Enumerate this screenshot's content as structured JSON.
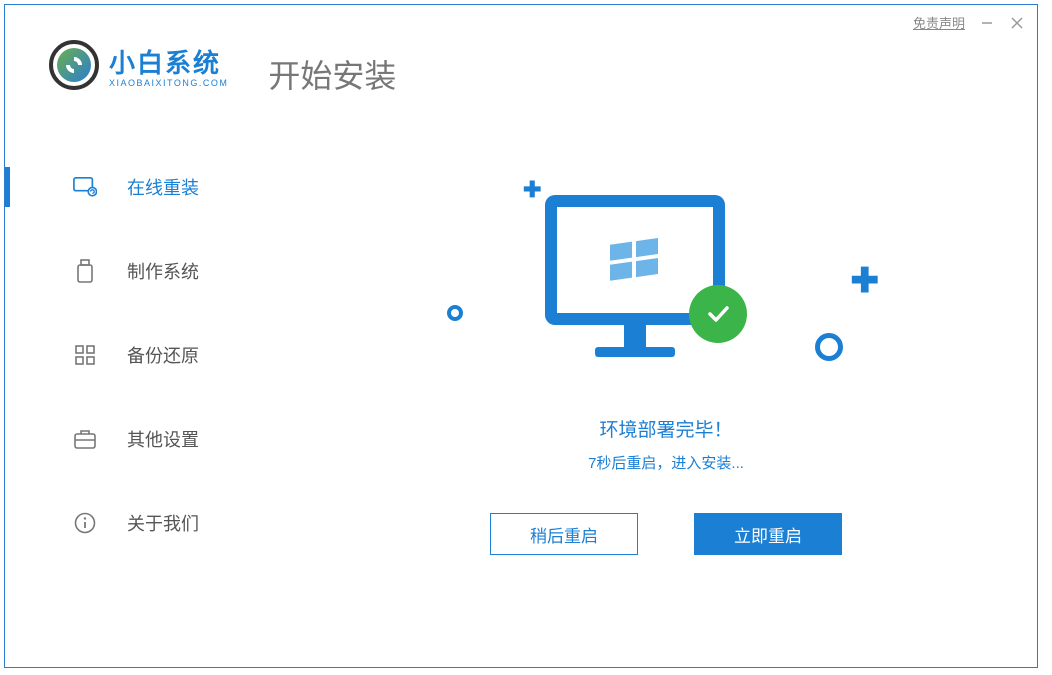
{
  "titlebar": {
    "disclaimer": "免责声明"
  },
  "logo": {
    "title": "小白系统",
    "subtitle": "XIAOBAIXITONG.COM"
  },
  "page_title": "开始安装",
  "sidebar": {
    "items": [
      {
        "label": "在线重装",
        "icon": "monitor-reinstall-icon",
        "active": true
      },
      {
        "label": "制作系统",
        "icon": "usb-icon",
        "active": false
      },
      {
        "label": "备份还原",
        "icon": "grid-icon",
        "active": false
      },
      {
        "label": "其他设置",
        "icon": "briefcase-icon",
        "active": false
      },
      {
        "label": "关于我们",
        "icon": "info-icon",
        "active": false
      }
    ]
  },
  "status": {
    "title": "环境部署完毕！",
    "subtitle": "7秒后重启，进入安装..."
  },
  "buttons": {
    "later": "稍后重启",
    "now": "立即重启"
  }
}
